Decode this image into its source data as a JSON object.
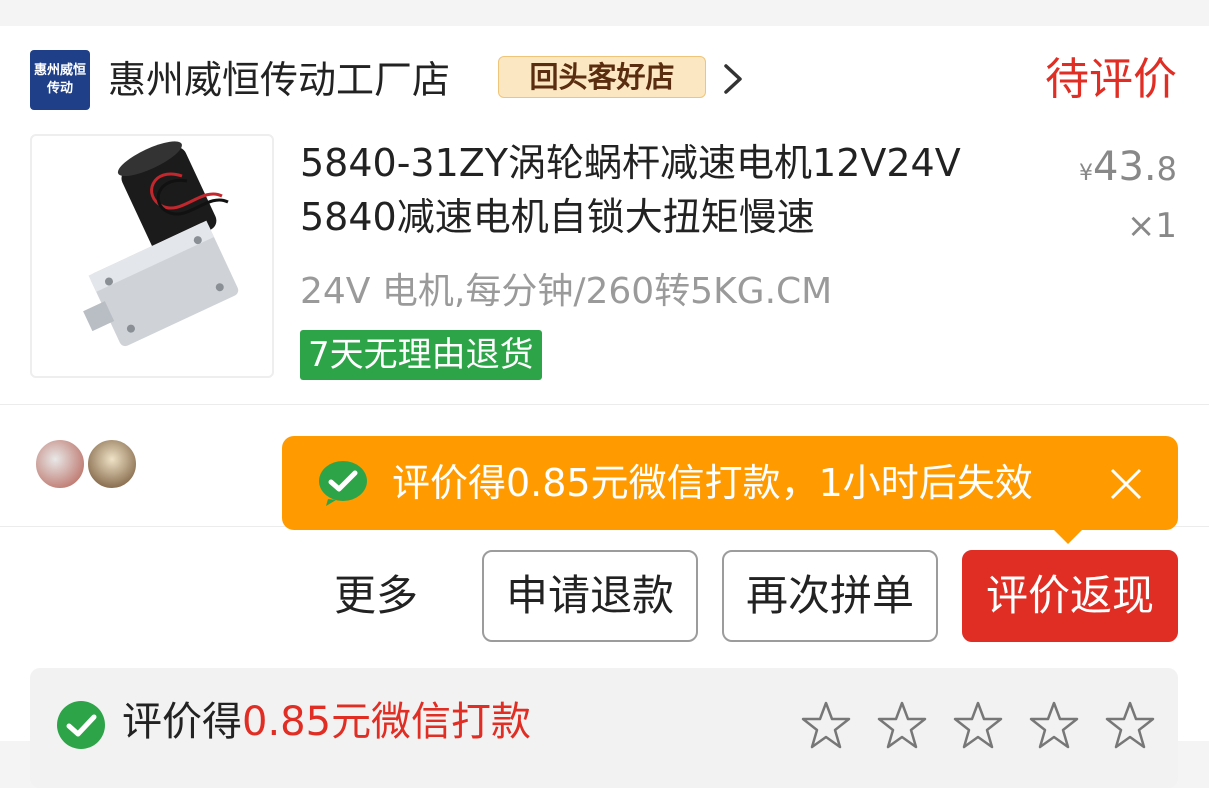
{
  "shop": {
    "logo_text_line1": "惠州威恒",
    "logo_text_line2": "传动",
    "name": "惠州威恒传动工厂店",
    "badge": "回头客好店",
    "status": "待评价"
  },
  "product": {
    "title_line1": "5840-31ZY涡轮蜗杆减速电机12V24V",
    "title_line2": "5840减速电机自锁大扭矩慢速",
    "price_symbol": "¥",
    "price_int": "43.",
    "price_dec": "8",
    "quantity": "×1",
    "spec": "24V 电机,每分钟/260转5KG.CM",
    "return_tag": "7天无理由退货"
  },
  "tooltip": {
    "text": "评价得0.85元微信打款，1小时后失效"
  },
  "actions": {
    "more": "更多",
    "refund": "申请退款",
    "reorder": "再次拼单",
    "review_cashback": "评价返现"
  },
  "review": {
    "label_prefix": "评价得",
    "label_highlight": "0.85元微信打款"
  },
  "colors": {
    "accent_red": "#e02e24",
    "tooltip_orange": "#ff9b00",
    "wechat_green": "#2ea449"
  }
}
